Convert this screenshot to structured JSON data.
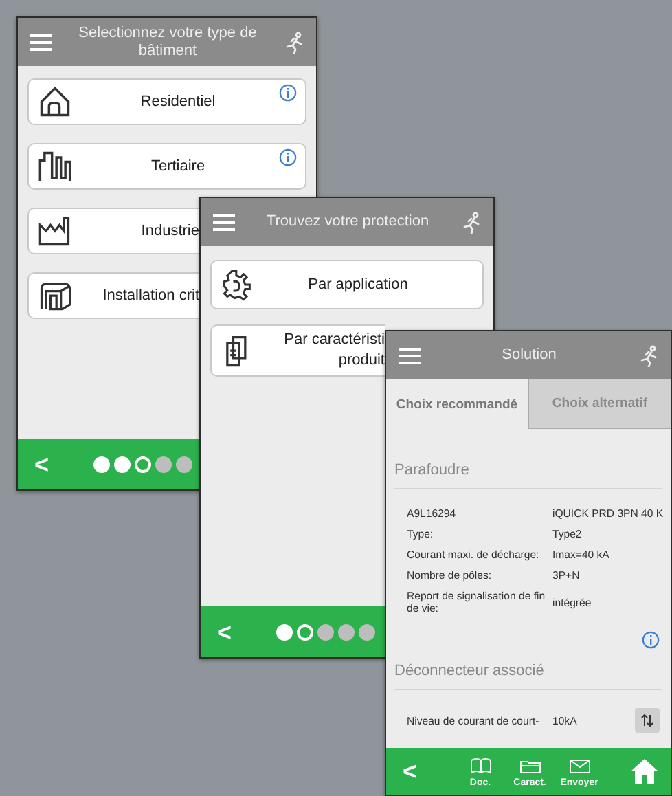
{
  "screens": [
    {
      "kind": "choice",
      "title": "Selectionnez votre type de bâtiment",
      "items": [
        {
          "label": "Residentiel",
          "info": true
        },
        {
          "label": "Tertiaire",
          "info": true
        },
        {
          "label": "Industrie"
        },
        {
          "label": "Installation crit"
        }
      ],
      "back": "<",
      "pager": [
        {
          "filled": true,
          "selected": false
        },
        {
          "filled": true,
          "selected": false
        },
        {
          "filled": false,
          "selected": true
        },
        {
          "filled": false,
          "selected": false
        },
        {
          "filled": false,
          "selected": false
        }
      ]
    },
    {
      "kind": "choice",
      "title": "Trouvez votre protection",
      "items": [
        {
          "label": "Par application",
          "info": false
        },
        {
          "label": "Par caractéristi\nproduit"
        }
      ],
      "back": "<",
      "pager": [
        {
          "filled": true,
          "selected": false
        },
        {
          "filled": false,
          "selected": true
        },
        {
          "filled": false,
          "selected": false
        },
        {
          "filled": false,
          "selected": false
        },
        {
          "filled": false,
          "selected": false
        }
      ]
    },
    {
      "kind": "solution",
      "title": "Solution",
      "tabs": [
        {
          "label": "Choix recommandé",
          "selected": true
        },
        {
          "label": "Choix alternatif",
          "selected": false
        }
      ],
      "sections": [
        {
          "title": "Parafoudre",
          "info": true,
          "rows": [
            {
              "label": "A9L16294",
              "value": "iQUICK PRD 3PN 40 K"
            },
            {
              "label": "Type:",
              "value": "Type2"
            },
            {
              "label": "Courant maxi. de décharge:",
              "value": "Imax=40 kA"
            },
            {
              "label": "Nombre de pôles:",
              "value": "3P+N"
            },
            {
              "label": "Report de signalisation de fin de vie:",
              "value": "intégrée"
            }
          ]
        },
        {
          "title": "Déconnecteur associé",
          "sort": true,
          "rows": [
            {
              "label": "Niveau de courant de court-",
              "value": "10kA"
            }
          ]
        }
      ],
      "back": "<",
      "actions": [
        "Doc.",
        "Caract.",
        "Envoyer"
      ]
    }
  ]
}
